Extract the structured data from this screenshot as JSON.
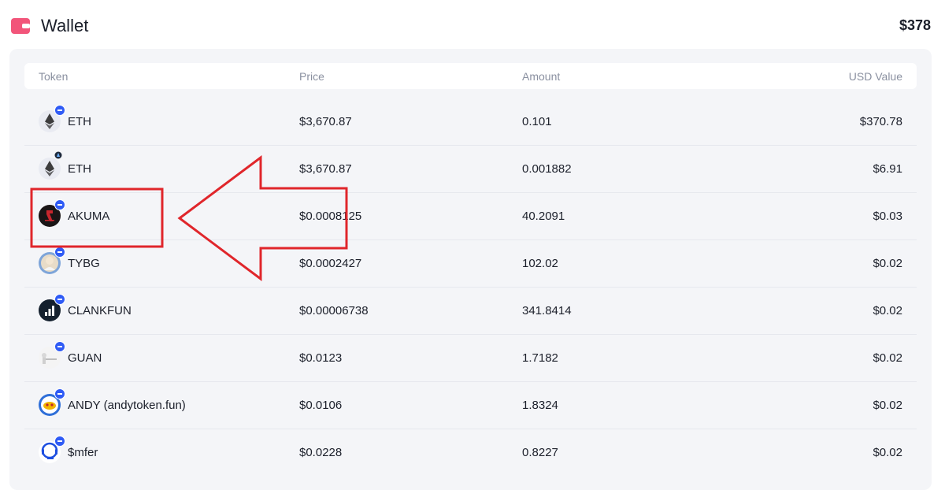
{
  "header": {
    "title": "Wallet",
    "total": "$378"
  },
  "colors": {
    "accent": "#2f5bf5",
    "wallet_icon": "#f2557a",
    "annotation": "#e0262b"
  },
  "table": {
    "columns": {
      "token": "Token",
      "price": "Price",
      "amount": "Amount",
      "usd": "USD Value"
    },
    "rows": [
      {
        "icon": "eth-icon",
        "badge": "minus",
        "name": "ETH",
        "price": "$3,670.87",
        "amount": "0.101",
        "usd": "$370.78"
      },
      {
        "icon": "eth-icon",
        "badge": "network",
        "name": "ETH",
        "price": "$3,670.87",
        "amount": "0.001882",
        "usd": "$6.91"
      },
      {
        "icon": "akuma-icon",
        "badge": "minus",
        "name": "AKUMA",
        "price": "$0.0008125",
        "amount": "40.2091",
        "usd": "$0.03"
      },
      {
        "icon": "tybg-icon",
        "badge": "minus",
        "name": "TYBG",
        "price": "$0.0002427",
        "amount": "102.02",
        "usd": "$0.02"
      },
      {
        "icon": "clankfun-icon",
        "badge": "minus",
        "name": "CLANKFUN",
        "price": "$0.00006738",
        "amount": "341.8414",
        "usd": "$0.02"
      },
      {
        "icon": "guan-icon",
        "badge": "minus",
        "name": "GUAN",
        "price": "$0.0123",
        "amount": "1.7182",
        "usd": "$0.02"
      },
      {
        "icon": "andy-icon",
        "badge": "minus",
        "name": "ANDY (andytoken.fun)",
        "price": "$0.0106",
        "amount": "1.8324",
        "usd": "$0.02"
      },
      {
        "icon": "mfer-icon",
        "badge": "minus",
        "name": "$mfer",
        "price": "$0.0228",
        "amount": "0.8227",
        "usd": "$0.02"
      }
    ]
  }
}
